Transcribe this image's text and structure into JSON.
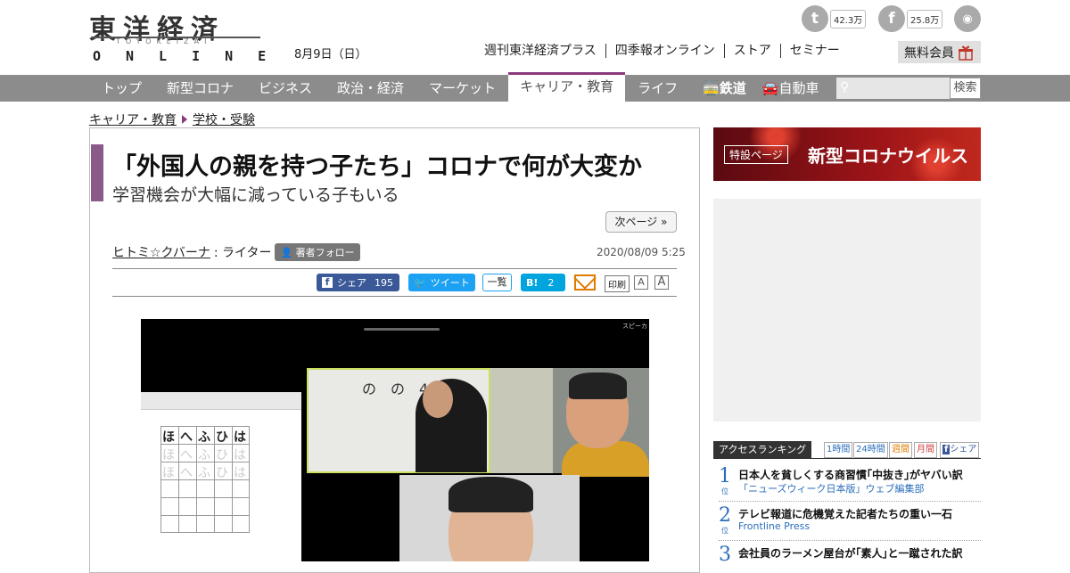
{
  "header": {
    "logo_kanji": "東洋経済",
    "logo_romaji": "TOYOKEIZAI",
    "logo_online": "ONLINE",
    "date": "8月9日（日）",
    "links": [
      "週刊東洋経済プラス",
      "四季報オンライン",
      "ストア",
      "セミナー"
    ],
    "member_label": "無料会員",
    "social": {
      "twitter_count": "42.3万",
      "facebook_count": "25.8万"
    },
    "icons": [
      "twitter-icon",
      "facebook-icon",
      "rss-icon",
      "gift-icon"
    ]
  },
  "nav": {
    "items": [
      "トップ",
      "新型コロナ",
      "ビジネス",
      "政治・経済",
      "マーケット",
      "キャリア・教育",
      "ライフ",
      "鉄道",
      "自動車"
    ],
    "active": "キャリア・教育",
    "search_placeholder": "",
    "search_button": "検索"
  },
  "breadcrumb": [
    "キャリア・教育",
    "学校・受験"
  ],
  "article": {
    "title": "「外国人の親を持つ子たち」コロナで何が大変か",
    "subtitle": "学習機会が大幅に減っている子もいる",
    "next_page": "次ページ »",
    "author_name": "ヒトミ☆クバーナ",
    "author_role": ": ライター",
    "follow_label": "著者フォロー",
    "published": "2020/08/09 5:25",
    "share": {
      "fb_label": "シェア",
      "fb_count": "195",
      "tweet_label": "ツイート",
      "list_label": "一覧",
      "hatena_label": "B!",
      "hatena_count": "2",
      "print_label": "印刷",
      "font_small": "A",
      "font_large": "A"
    },
    "photo": {
      "speaker_label": "スピーカ",
      "kana_row": "ほへふひは",
      "board_text": "の　の　4/2"
    }
  },
  "sidebar": {
    "banner_tag": "特設ページ",
    "banner_text": "新型コロナウイルス",
    "ranking_title": "アクセスランキング",
    "ranking_tabs": [
      "1時間",
      "24時間",
      "週間",
      "月間",
      "シェア"
    ],
    "ranking_tab_colors": [
      "#2a6ebb",
      "#2a6ebb",
      "#e07b00",
      "#d04040",
      "#3b5998"
    ],
    "ranking": [
      {
        "num": "1",
        "unit": "位",
        "title": "日本人を貧しくする商習慣｢中抜き｣がヤバい訳",
        "source": "「ニューズウィーク日本版」ウェブ編集部"
      },
      {
        "num": "2",
        "unit": "位",
        "title": "テレビ報道に危機覚えた記者たちの重い一石",
        "source": "Frontline Press"
      },
      {
        "num": "3",
        "unit": "位",
        "title": "会社員のラーメン屋台が｢素人｣と一蹴された訳",
        "source": ""
      }
    ]
  },
  "colors": {
    "nav_bg": "#8c8c8c",
    "accent": "#8a3a7c",
    "link_blue": "#2a6ebb"
  }
}
